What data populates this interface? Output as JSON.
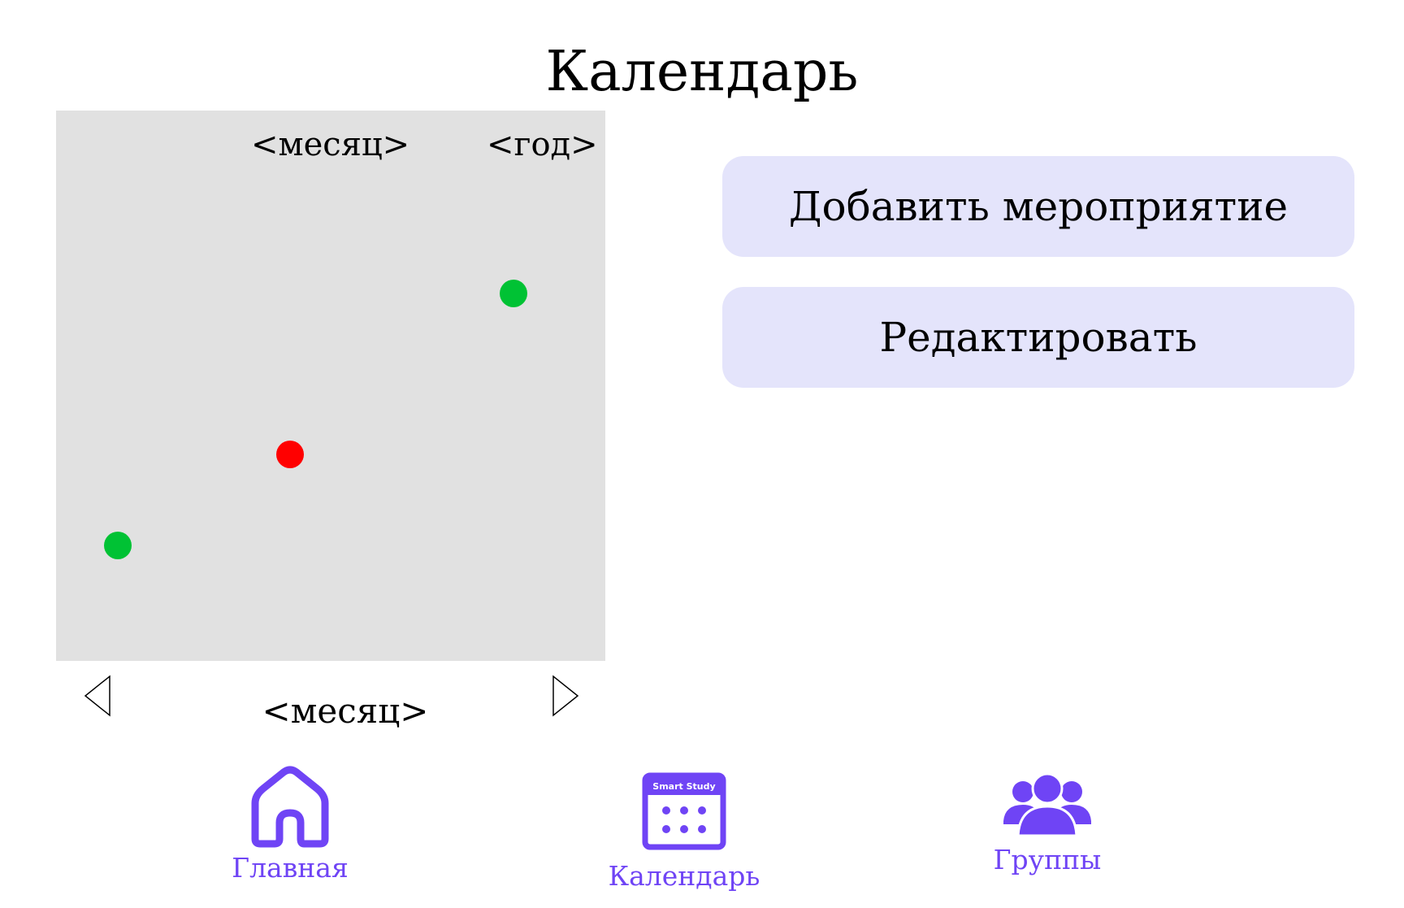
{
  "header": {
    "title": "Календарь"
  },
  "calendar": {
    "month_header": "<месяц>",
    "year_header": "<год>",
    "event_colors": {
      "green": "#00c234",
      "red": "#ff0000"
    },
    "nav": {
      "month_label": "<месяц>",
      "prev_icon": "triangle-left-icon",
      "next_icon": "triangle-right-icon"
    }
  },
  "actions": {
    "add_event_label": "Добавить мероприятие",
    "edit_label": "Редактировать",
    "button_color": "#e4e4fb"
  },
  "bottom_nav": {
    "accent_color": "#6f44f5",
    "items": [
      {
        "label": "Главная",
        "icon": "home-icon"
      },
      {
        "label": "Календарь",
        "icon": "calendar-icon",
        "icon_text": "Smart Study"
      },
      {
        "label": "Группы",
        "icon": "group-icon"
      }
    ]
  }
}
